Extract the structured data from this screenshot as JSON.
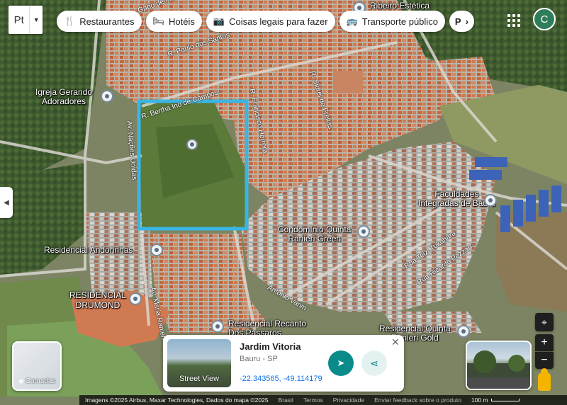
{
  "toolbar": {
    "logo_text": "Pt",
    "chips": [
      {
        "icon": "restaurant-icon",
        "glyph": "🍴",
        "label": "Restaurantes"
      },
      {
        "icon": "hotel-icon",
        "glyph": "🛏",
        "label": "Hotéis"
      },
      {
        "icon": "camera-icon",
        "glyph": "📷",
        "label": "Coisas legais para fazer"
      },
      {
        "icon": "transit-icon",
        "glyph": "🚌",
        "label": "Transporte público"
      },
      {
        "icon": "parking-icon",
        "glyph": "P",
        "label": "›"
      }
    ],
    "avatar_initial": "C"
  },
  "map": {
    "place_labels": [
      {
        "name": "igreja",
        "text": "Igreja Gerando\nAdoradores"
      },
      {
        "name": "faculdades",
        "text": "Faculdades\nIntegradas de Bauru"
      },
      {
        "name": "condominio",
        "text": "Condomínio Quinta\nRanieri Green"
      },
      {
        "name": "andorinhas",
        "text": "Residencial Andorinhas"
      },
      {
        "name": "drumond",
        "text": "RESIDENCIAL\nDRUMOND"
      },
      {
        "name": "recanto",
        "text": "Residencial Recanto\nDos Pássaros"
      },
      {
        "name": "quinta-gold",
        "text": "Residencial Quinta\nRanieri Gold"
      },
      {
        "name": "ribeiro",
        "text": "Ribeiro Estética"
      }
    ],
    "road_labels": [
      {
        "name": "r-paulo",
        "text": "R. Paulo dos Santos"
      },
      {
        "name": "r-gabo",
        "text": "Gabo de Mattos"
      },
      {
        "name": "r-bertha",
        "text": "R. Bertha Ino de Campos"
      },
      {
        "name": "r-sidrei",
        "text": "R. Sidrei de Freitas"
      },
      {
        "name": "r-francisco",
        "text": "R. Francisco Herrera"
      },
      {
        "name": "av-nacoes",
        "text": "Av. Nações Unidas"
      },
      {
        "name": "av-maria",
        "text": "Av. Maria Ranieri"
      },
      {
        "name": "r-antonio",
        "text": "Antônio Vanin"
      },
      {
        "name": "r-telzi",
        "text": "Rua Telzi Tukuhara"
      },
      {
        "name": "r-ricardo",
        "text": "Rua Ricardo Pezzan"
      }
    ],
    "highlight_color": "#3bb5e3"
  },
  "layers": {
    "label": "Camadas"
  },
  "info_card": {
    "title": "Jardim Vitoria",
    "subtitle": "Bauru - SP",
    "coordinates": "-22.343565, -49.114179",
    "street_view_label": "Street View"
  },
  "controls": {
    "zoom_in": "+",
    "zoom_out": "−"
  },
  "footer": {
    "attribution": "Imagens ©2025 Airbus, Maxar Technologies, Dados do mapa ©2025",
    "links": [
      "Brasil",
      "Termos",
      "Privacidade",
      "Enviar feedback sobre o produto"
    ],
    "scale": "100 m"
  }
}
